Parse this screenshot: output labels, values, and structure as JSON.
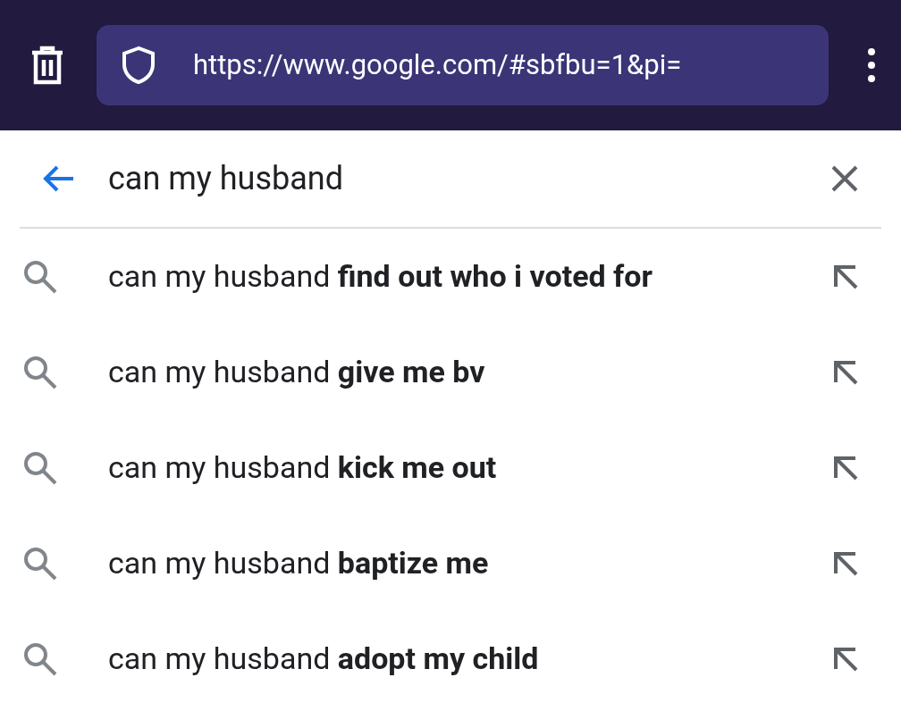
{
  "browser": {
    "url": "https://www.google.com/#sbfbu=1&pi="
  },
  "search": {
    "value": "can my husband"
  },
  "suggestions": [
    {
      "text": "can my husband **find out who i voted for**"
    },
    {
      "text": "can my husband **give me bv**"
    },
    {
      "text": "can my husband **kick me out**"
    },
    {
      "text": "can my husband **baptize me**"
    },
    {
      "text": "can my husband **adopt my child**"
    }
  ]
}
